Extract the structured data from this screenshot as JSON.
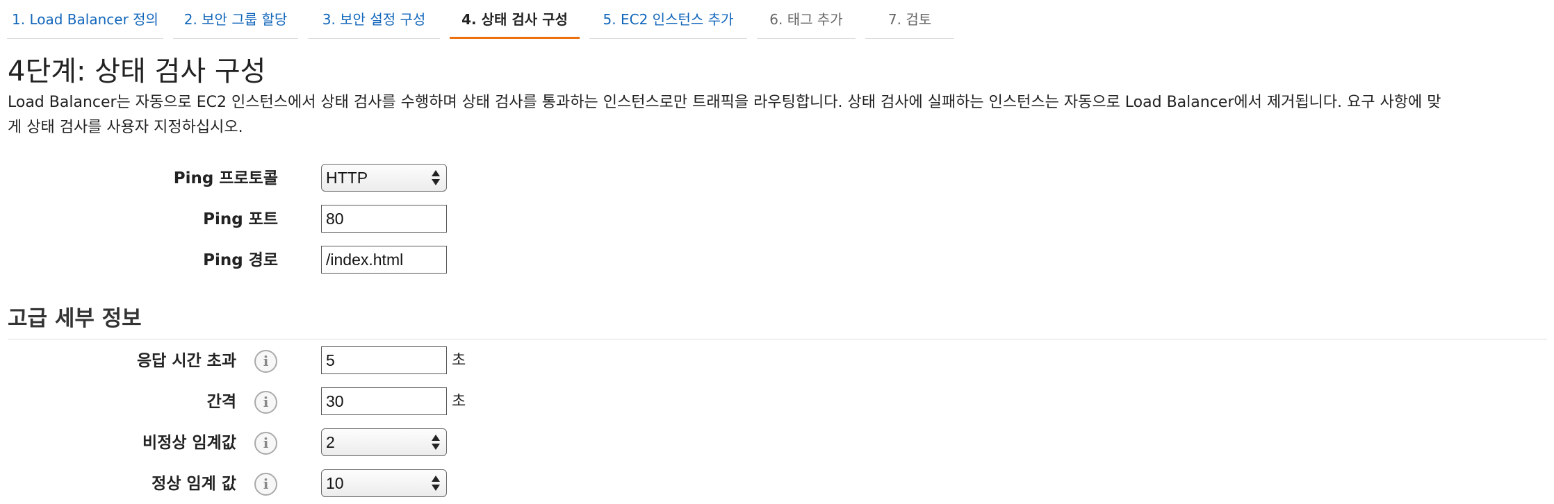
{
  "tabs": [
    {
      "label": "1. Load Balancer 정의",
      "state": "done"
    },
    {
      "label": "2. 보안 그룹 할당",
      "state": "done"
    },
    {
      "label": "3. 보안 설정 구성",
      "state": "done"
    },
    {
      "label": "4. 상태 검사 구성",
      "state": "active"
    },
    {
      "label": "5. EC2 인스턴스 추가",
      "state": "done"
    },
    {
      "label": "6. 태그 추가",
      "state": "future"
    },
    {
      "label": "7. 검토",
      "state": "future"
    }
  ],
  "page": {
    "title": "4단계: 상태 검사 구성",
    "description": "Load Balancer는 자동으로 EC2 인스턴스에서 상태 검사를 수행하며 상태 검사를 통과하는 인스턴스로만 트래픽을 라우팅합니다. 상태 검사에 실패하는 인스턴스는 자동으로 Load Balancer에서 제거됩니다. 요구 사항에 맞게 상태 검사를 사용자 지정하십시오."
  },
  "ping": {
    "protocol_label": "Ping 프로토콜",
    "protocol_value": "HTTP",
    "port_label": "Ping 포트",
    "port_value": "80",
    "path_label": "Ping 경로",
    "path_value": "/index.html"
  },
  "advanced": {
    "title": "고급 세부 정보",
    "timeout_label": "응답 시간 초과",
    "timeout_value": "5",
    "timeout_unit": "초",
    "interval_label": "간격",
    "interval_value": "30",
    "interval_unit": "초",
    "unhealthy_label": "비정상 임계값",
    "unhealthy_value": "2",
    "healthy_label": "정상 임계 값",
    "healthy_value": "10",
    "info_glyph": "i"
  },
  "colors": {
    "link": "#1166bb",
    "active_tab_underline": "#ec7211",
    "future_tab": "#666666"
  }
}
